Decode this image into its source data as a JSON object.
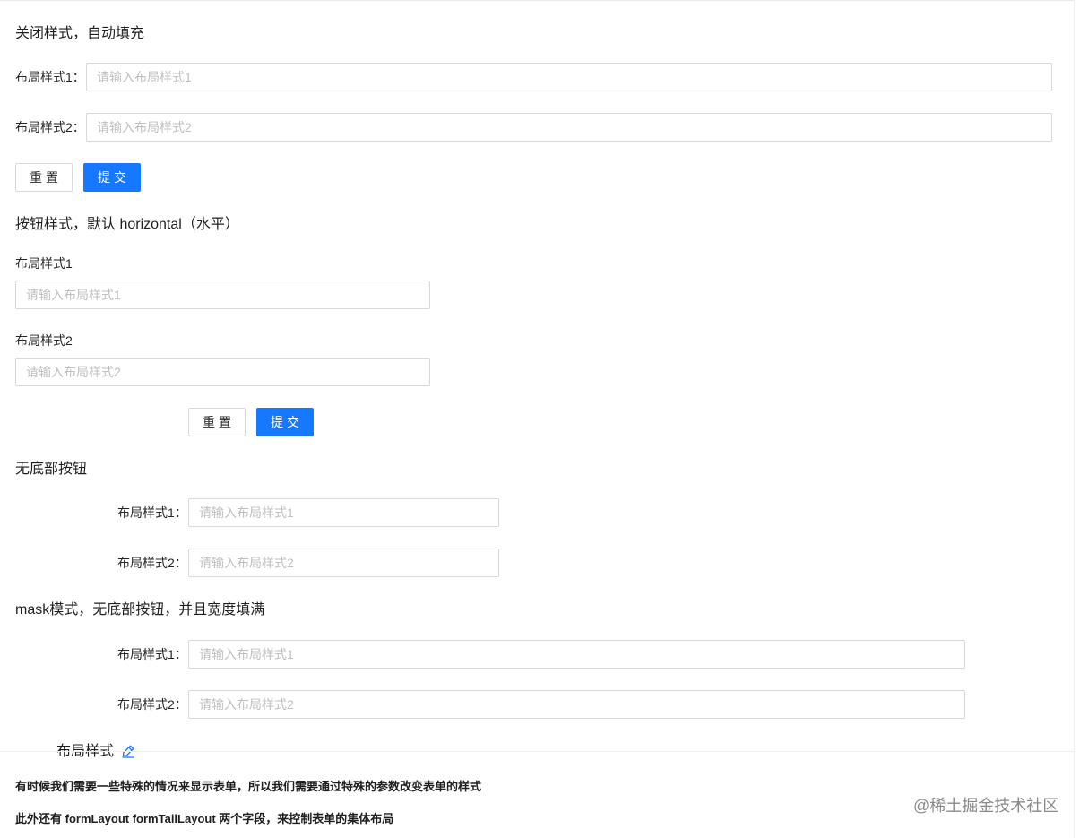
{
  "section1": {
    "title": "关闭样式，自动填充",
    "field1_label": "布局样式1：",
    "field1_placeholder": "请输入布局样式1",
    "field2_label": "布局样式2：",
    "field2_placeholder": "请输入布局样式2",
    "reset_label": "重置",
    "submit_label": "提交"
  },
  "section2": {
    "title": "按钮样式，默认 horizontal（水平）",
    "field1_label": "布局样式1",
    "field1_placeholder": "请输入布局样式1",
    "field2_label": "布局样式2",
    "field2_placeholder": "请输入布局样式2",
    "reset_label": "重置",
    "submit_label": "提交"
  },
  "section3": {
    "title": "无底部按钮",
    "field1_label": "布局样式1：",
    "field1_placeholder": "请输入布局样式1",
    "field2_label": "布局样式2：",
    "field2_placeholder": "请输入布局样式2"
  },
  "section4": {
    "title": "mask模式，无底部按钮，并且宽度填满",
    "field1_label": "布局样式1：",
    "field1_placeholder": "请输入布局样式1",
    "field2_label": "布局样式2：",
    "field2_placeholder": "请输入布局样式2"
  },
  "footer": {
    "title": "布局样式",
    "description1": "有时候我们需要一些特殊的情况来显示表单，所以我们需要通过特殊的参数改变表单的样式",
    "description2": "此外还有 formLayout formTailLayout 两个字段，来控制表单的集体布局",
    "watermark": "@稀土掘金技术社区"
  },
  "colors": {
    "primary": "#1677ff",
    "border": "#d9d9d9",
    "placeholder": "#bfbfbf"
  }
}
